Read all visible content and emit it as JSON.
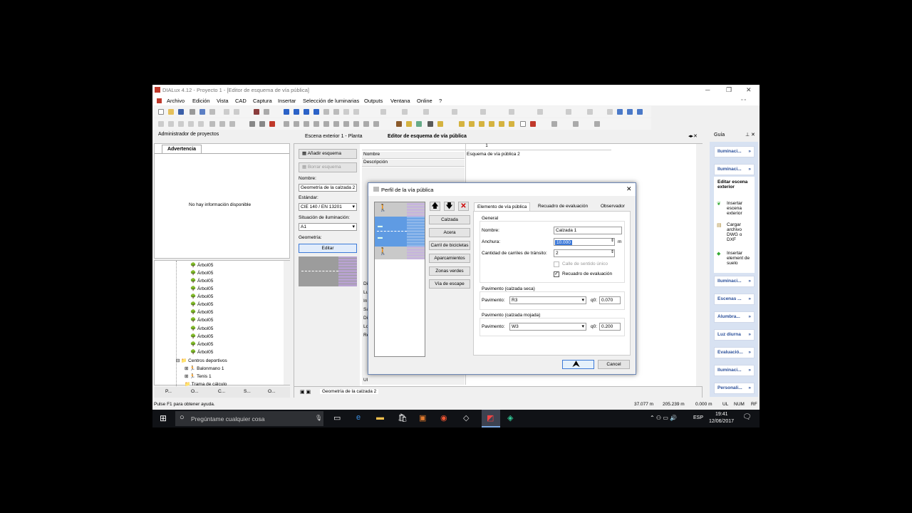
{
  "app": {
    "title": "DIALux 4.12 - Proyecto 1 - [Editor de esquema de vía pública]"
  },
  "menu": [
    "Archivo",
    "Edición",
    "Vista",
    "CAD",
    "Captura",
    "Insertar",
    "Selección de luminarias",
    "Outputs",
    "Ventana",
    "Online",
    "?"
  ],
  "left_panel": {
    "title": "Administrador de proyectos",
    "tab": "Advertencia",
    "message": "No hay información disponible",
    "tree": [
      "Árbol05",
      "Árbol05",
      "Árbol05",
      "Árbol05",
      "Árbol05",
      "Árbol05",
      "Árbol05",
      "Árbol05",
      "Árbol05",
      "Árbol05",
      "Árbol05",
      "Árbol05",
      "Centros deportivos",
      "Balonmano 1",
      "Tenis 1",
      "Trama de cálculo"
    ],
    "bottom_tabs": [
      "P...",
      "O...",
      "C...",
      "S...",
      "O..."
    ]
  },
  "doc_tabs": [
    "Escena exterior 1 - Planta",
    "Editor de esquema de vía pública"
  ],
  "editor": {
    "add": "Añadir esquema",
    "delete": "Borrar esquema",
    "name_label": "Nombre:",
    "name_value": "Geometría de la calzada 2",
    "std_label": "Estándar:",
    "std_value": "CIE 140 / EN 13201",
    "sit_label": "Situación de iluminación:",
    "sit_value": "A1",
    "geo_label": "Geometría:",
    "edit": "Editar",
    "col_header": "1",
    "row_nombre": "Nombre",
    "row_desc": "Descripción",
    "cell_nombre": "Esquema de vía pública 2",
    "side_letters": [
      "R",
      "Lu",
      "Lu",
      "Di",
      "Lu",
      "In",
      "Sa",
      "Di",
      "Lo",
      "Re",
      "Ul",
      "Ul"
    ],
    "bottom_tab": "Geometría de la calzada 2"
  },
  "dialog": {
    "title": "Perfil de la vía pública",
    "buttons": [
      "Calzada",
      "Acera",
      "Carril de bicicletas",
      "Aparcamientos",
      "Zonas verdes",
      "Vía de escape"
    ],
    "tabs": [
      "Elemento de vía pública",
      "Recuadro de evaluación",
      "Observador"
    ],
    "general": "General",
    "nombre_label": "Nombre:",
    "nombre_value": "Calzada 1",
    "anchura_label": "Anchura:",
    "anchura_value": "10.000",
    "unit": "m",
    "carriles_label": "Cantidad de carriles de tránsito:",
    "carriles_value": "2",
    "sentido": "Calle de sentido único",
    "recuadro": "Recuadro de evaluación",
    "pav_seca": "Pavimento (calzada seca)",
    "pav_label": "Pavimento:",
    "pav_seca_value": "R3",
    "q0_label": "q0:",
    "q0_seca": "0.070",
    "pav_mojada": "Pavimento (calzada mojada)",
    "pav_mojada_value": "W3",
    "q0_mojada": "0.200",
    "ok": "",
    "cancel": "Cancel"
  },
  "guide": {
    "title": "Guía",
    "buttons": [
      "Iluminaci...",
      "Iluminaci...",
      "Iluminaci...",
      "Escenas ...",
      "Alumbra...",
      "Luz diurna",
      "Evaluació...",
      "Iluminaci...",
      "Personali..."
    ],
    "heading": "Editar escena exterior",
    "links": [
      "Insertar escena exterior",
      "Cargar archivo DWG o DXF",
      "Insertar element de suelo"
    ]
  },
  "status": {
    "help": "Pulse F1 para obtener ayuda.",
    "x": "37.077 m",
    "y": "205.239 m",
    "z": "0.000 m",
    "ul": "UL",
    "num": "NUM",
    "rf": "RF"
  },
  "taskbar": {
    "search": "Pregúntame cualquier cosa",
    "lang": "ESP",
    "time": "19:41",
    "date": "12/06/2017"
  }
}
